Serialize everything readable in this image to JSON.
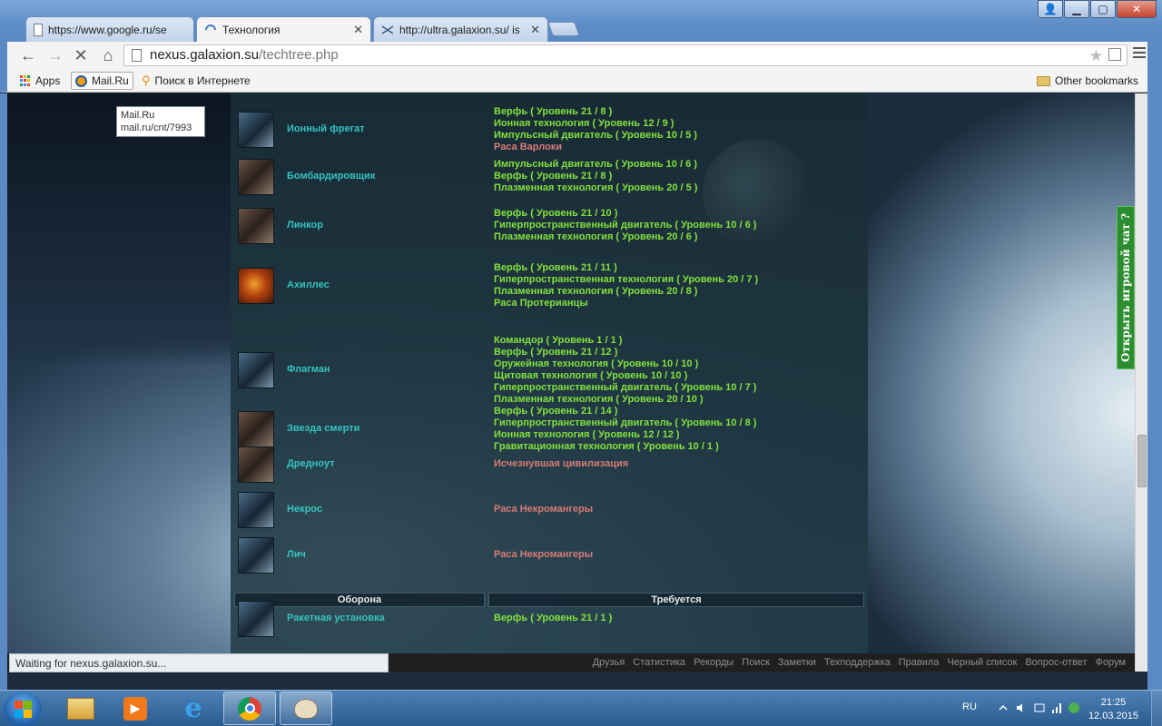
{
  "browser": {
    "tabs": [
      {
        "label": "https://www.google.ru/se",
        "active": false
      },
      {
        "label": "Технология",
        "active": true
      },
      {
        "label": "http://ultra.galaxion.su/ is",
        "active": false
      }
    ],
    "url_host": "nexus.galaxion.su",
    "url_path": "/techtree.php",
    "bookmarks": {
      "apps": "Apps",
      "mailru": "Mail.Ru",
      "search": "Поиск в Интернете",
      "other": "Other bookmarks"
    },
    "tooltip": {
      "title": "Mail.Ru",
      "url": "mail.ru/cnt/7993"
    },
    "status": "Waiting for nexus.galaxion.su..."
  },
  "page": {
    "ships": [
      {
        "name": "Ионный фрегат",
        "img": "blue",
        "reqs": [
          {
            "text": "Верфь ( Уровень 21 / 8 )",
            "met": true
          },
          {
            "text": "Ионная технология ( Уровень 12 / 9 )",
            "met": true
          },
          {
            "text": "Импульсный двигатель ( Уровень 10 / 5 )",
            "met": true
          },
          {
            "text": "Раса Варлоки",
            "met": false
          }
        ]
      },
      {
        "name": "Бомбардировщик",
        "img": "brown",
        "reqs": [
          {
            "text": "Импульсный двигатель ( Уровень 10 / 6 )",
            "met": true
          },
          {
            "text": "Верфь ( Уровень 21 / 8 )",
            "met": true
          },
          {
            "text": "Плазменная технология ( Уровень 20 / 5 )",
            "met": true
          }
        ]
      },
      {
        "name": "Линкор",
        "img": "brown",
        "reqs": [
          {
            "text": "Верфь ( Уровень 21 / 10 )",
            "met": true
          },
          {
            "text": "Гиперпространственный двигатель ( Уровень 10 / 6 )",
            "met": true
          },
          {
            "text": "Плазменная технология ( Уровень 20 / 6 )",
            "met": true
          }
        ]
      },
      {
        "name": "Ахиллес",
        "img": "fire",
        "reqs": [
          {
            "text": "Верфь ( Уровень 21 / 11 )",
            "met": true
          },
          {
            "text": "Гиперпространственная технология ( Уровень 20 / 7 )",
            "met": true
          },
          {
            "text": "Плазменная технология ( Уровень 20 / 8 )",
            "met": true
          },
          {
            "text": "Раса Протерианцы",
            "met": true
          }
        ]
      },
      {
        "name": "Флагман",
        "img": "blue",
        "reqs": [
          {
            "text": "Командор ( Уровень 1 / 1 )",
            "met": true
          },
          {
            "text": "Верфь ( Уровень 21 / 12 )",
            "met": true
          },
          {
            "text": "Оружейная технология ( Уровень 10 / 10 )",
            "met": true
          },
          {
            "text": "Щитовая технология ( Уровень 10 / 10 )",
            "met": true
          },
          {
            "text": "Гиперпространственный двигатель ( Уровень 10 / 7 )",
            "met": true
          },
          {
            "text": "Плазменная технология ( Уровень 20 / 10 )",
            "met": true
          }
        ]
      },
      {
        "name": "Звезда смерти",
        "img": "brown",
        "reqs": [
          {
            "text": "Верфь ( Уровень 21 / 14 )",
            "met": true
          },
          {
            "text": "Гиперпространственный двигатель ( Уровень 10 / 8 )",
            "met": true
          },
          {
            "text": "Ионная технология ( Уровень 12 / 12 )",
            "met": true
          },
          {
            "text": "Гравитационная технология ( Уровень 10 / 1 )",
            "met": true
          }
        ]
      },
      {
        "name": "Дредноут",
        "img": "brown",
        "reqs": [
          {
            "text": "Исчезнувшая цивилизация",
            "met": false
          }
        ]
      },
      {
        "name": "Некрос",
        "img": "blue",
        "reqs": [
          {
            "text": "Раса Некромангеры",
            "met": false
          }
        ]
      },
      {
        "name": "Лич",
        "img": "blue",
        "reqs": [
          {
            "text": "Раса Некромангеры",
            "met": false
          }
        ]
      }
    ],
    "defense_header": "Оборона",
    "requires_header": "Требуется",
    "defense": [
      {
        "name": "Ракетная установка",
        "img": "blue",
        "reqs": [
          {
            "text": "Верфь ( Уровень 21 / 1 )",
            "met": true
          }
        ]
      }
    ],
    "chat_tab": "Открыть игровой чат ?",
    "footer_links": [
      "Друзья",
      "Статистика",
      "Рекорды",
      "Поиск",
      "Заметки",
      "Техподдержка",
      "Правила",
      "Черный список",
      "Вопрос-ответ",
      "Форум"
    ]
  },
  "taskbar": {
    "lang": "RU",
    "time": "21:25",
    "date": "12.03.2015"
  }
}
